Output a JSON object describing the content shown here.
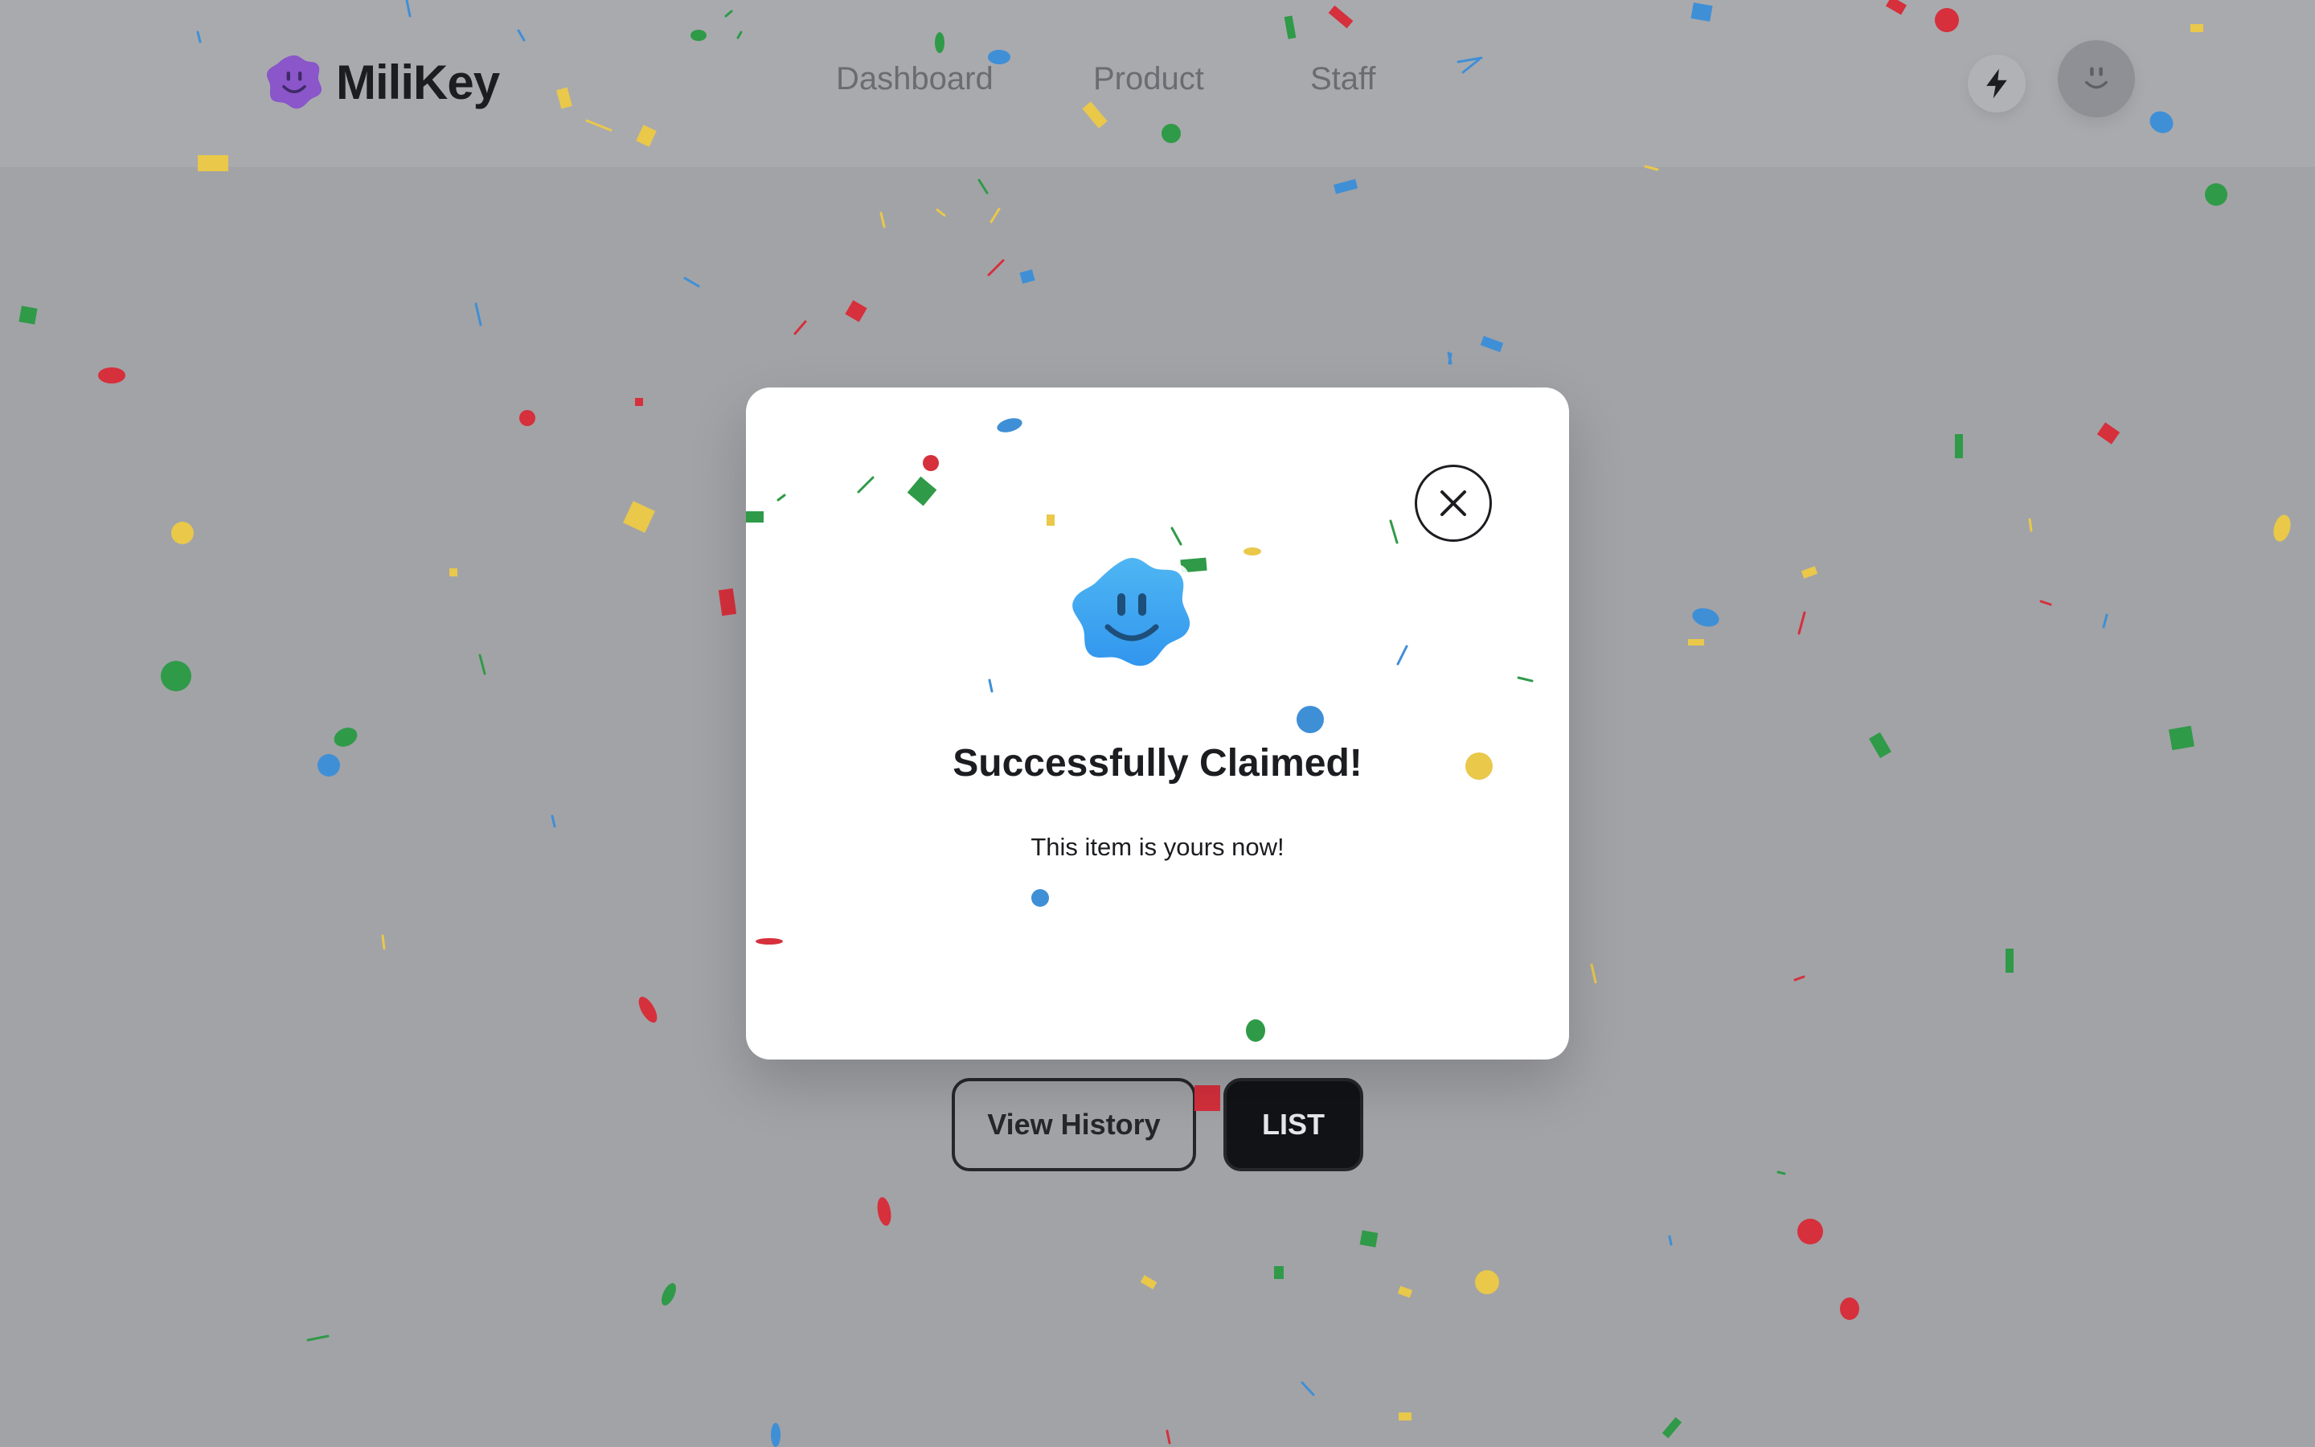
{
  "header": {
    "brand": "MiliKey",
    "logo_icon": "smiley-badge-icon",
    "nav": [
      "Dashboard",
      "Product",
      "Staff"
    ],
    "actions": {
      "bolt_icon": "lightning-bolt-icon",
      "avatar_icon": "smiley-avatar-icon"
    }
  },
  "main": {
    "buttons": {
      "history_label": "View History",
      "list_label": "LIST"
    }
  },
  "modal": {
    "title": "Successfully Claimed!",
    "message": "This item is yours now!",
    "icon": "smiley-success-icon",
    "close_icon": "close-icon"
  },
  "colors": {
    "brand_purple": "#8a56c9",
    "success_blue": "#3fa6ee",
    "confetti": [
      "#3f8fd6",
      "#d5303c",
      "#e9c84a",
      "#2f9a48"
    ],
    "overlay": "#a2a3a7"
  }
}
